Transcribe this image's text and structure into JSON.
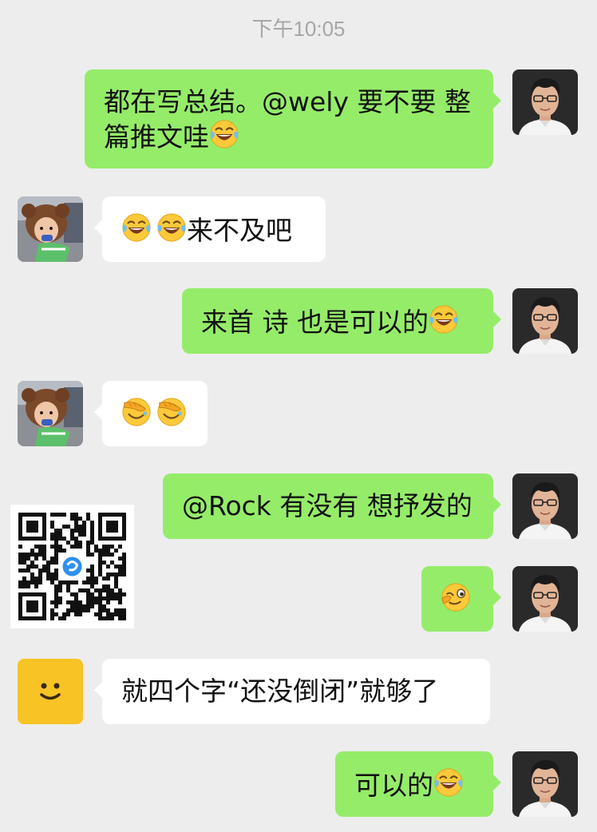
{
  "timestamp": "下午10:05",
  "messages": [
    {
      "side": "right",
      "sender": "me",
      "text": "都在写总结。@wely 要不要 整篇推文哇",
      "emoji": [
        "tears-of-joy"
      ]
    },
    {
      "side": "left",
      "sender": "child-avatar",
      "text": "来不及吧",
      "emoji_before": [
        "tears-of-joy",
        "tears-of-joy"
      ]
    },
    {
      "side": "right",
      "sender": "me",
      "text": "来首 诗 也是可以的",
      "emoji": [
        "tears-of-joy"
      ]
    },
    {
      "side": "left",
      "sender": "child-avatar",
      "text": "",
      "emoji_before": [
        "facepalm",
        "facepalm"
      ]
    },
    {
      "side": "right",
      "sender": "me",
      "text": "@Rock 有没有 想抒发的"
    },
    {
      "side": "right",
      "sender": "me",
      "text": "",
      "emoji": [
        "wink-face"
      ]
    },
    {
      "side": "left",
      "sender": "smiley-avatar",
      "text": "就四个字“还没倒闭”就够了"
    },
    {
      "side": "right",
      "sender": "me",
      "text": "可以的",
      "emoji": [
        "tears-of-joy"
      ]
    }
  ],
  "m1": {
    "line1": "都在写总结。@wely 要不要 整",
    "line2": "篇推文哇"
  },
  "m2": {
    "text": "来不及吧"
  },
  "m3": {
    "text": "来首 诗 也是可以的"
  },
  "m5": {
    "text": "@Rock 有没有 想抒发的"
  },
  "m7": {
    "text": "就四个字“还没倒闭”就够了"
  },
  "m8": {
    "text": "可以的"
  },
  "colors": {
    "background": "#ededed",
    "outgoing_bubble": "#95ec69",
    "incoming_bubble": "#ffffff",
    "timestamp": "#a6a6a6",
    "smiley_avatar": "#f7c325"
  },
  "icons": [
    "tears-of-joy-emoji",
    "facepalm-emoji",
    "wink-emoji",
    "qr-code",
    "smiley-face"
  ]
}
